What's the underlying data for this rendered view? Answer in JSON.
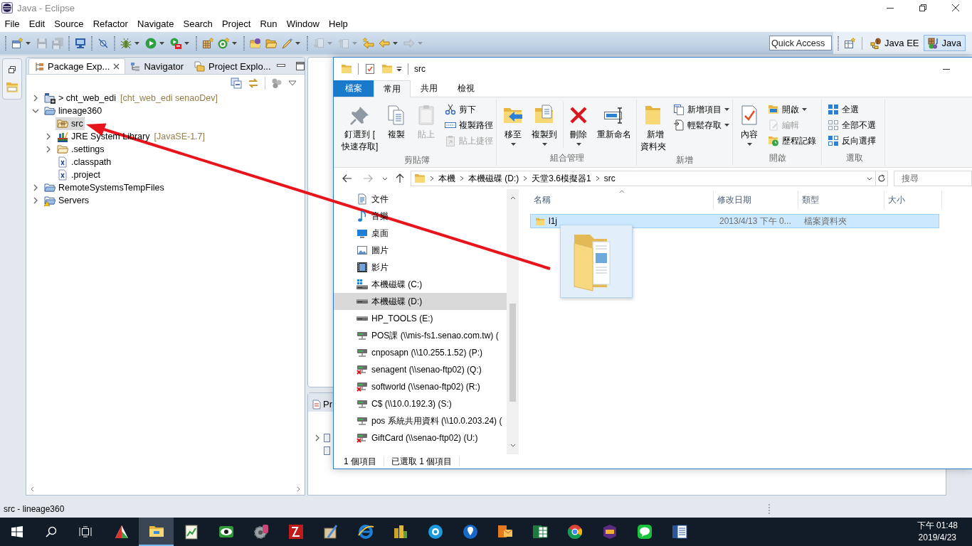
{
  "eclipse": {
    "title": "Java - Eclipse",
    "menu": [
      "File",
      "Edit",
      "Source",
      "Refactor",
      "Navigate",
      "Search",
      "Project",
      "Run",
      "Window",
      "Help"
    ],
    "toolbar": [
      {
        "kind": "grip"
      },
      {
        "kind": "new",
        "disabled": false,
        "dropdown": true
      },
      {
        "kind": "save",
        "disabled": true,
        "dropdown": false
      },
      {
        "kind": "save-all",
        "disabled": true,
        "dropdown": false
      },
      {
        "kind": "grip"
      },
      {
        "kind": "display",
        "disabled": false,
        "dropdown": false
      },
      {
        "kind": "grip"
      },
      {
        "kind": "skip-breakpoints",
        "disabled": false,
        "dropdown": false
      },
      {
        "kind": "grip"
      },
      {
        "kind": "debug",
        "disabled": false,
        "dropdown": true
      },
      {
        "kind": "run",
        "disabled": false,
        "dropdown": true
      },
      {
        "kind": "external-tools",
        "disabled": false,
        "dropdown": true
      },
      {
        "kind": "grip"
      },
      {
        "kind": "open-type",
        "disabled": false,
        "dropdown": false
      },
      {
        "kind": "new-class",
        "disabled": false,
        "dropdown": true
      },
      {
        "kind": "grip"
      },
      {
        "kind": "open-task",
        "disabled": false,
        "dropdown": false
      },
      {
        "kind": "open-folder",
        "disabled": false,
        "dropdown": false
      },
      {
        "kind": "brush",
        "disabled": false,
        "dropdown": true
      },
      {
        "kind": "grip"
      },
      {
        "kind": "next-annotation",
        "disabled": true,
        "dropdown": true
      },
      {
        "kind": "prev-annotation",
        "disabled": true,
        "dropdown": true
      },
      {
        "kind": "last-edit",
        "disabled": false,
        "dropdown": false
      },
      {
        "kind": "back",
        "disabled": false,
        "dropdown": true
      },
      {
        "kind": "forward",
        "disabled": true,
        "dropdown": true
      }
    ],
    "quick_access": {
      "placeholder": "Quick Access"
    },
    "perspectives": [
      {
        "label": "Java EE",
        "selected": false
      },
      {
        "label": "Java",
        "selected": true
      }
    ],
    "view_tabs": [
      {
        "label": "Package Exp...",
        "selected": true
      },
      {
        "label": "Navigator",
        "selected": false
      },
      {
        "label": "Project Explo...",
        "selected": false
      }
    ],
    "tree": [
      {
        "label": "> cht_web_edi",
        "decoration": "[cht_web_edi senaoDev]",
        "kind": "git-project",
        "expanded": false,
        "selected": false
      },
      {
        "label": "lineage360",
        "kind": "project",
        "expanded": true,
        "selected": false,
        "children": [
          {
            "label": "src",
            "kind": "source-folder",
            "selected": true
          },
          {
            "label": "JRE System Library",
            "decoration": "[JavaSE-1.7]",
            "kind": "library",
            "expanded": false,
            "selected": false
          },
          {
            "label": ".settings",
            "kind": "folder",
            "expanded": false,
            "selected": false
          },
          {
            "label": ".classpath",
            "kind": "xml-file",
            "selected": false
          },
          {
            "label": ".project",
            "kind": "xml-file",
            "selected": false
          }
        ]
      },
      {
        "label": "RemoteSystemsTempFiles",
        "kind": "project",
        "expanded": false,
        "selected": false
      },
      {
        "label": "Servers",
        "kind": "project-warning",
        "expanded": false,
        "selected": false
      }
    ],
    "bottom_view_tab": "Pr",
    "status_bar": "src - lineage360"
  },
  "explorer": {
    "title": "src",
    "ribbon_tabs": [
      {
        "label": "檔案",
        "kind": "file",
        "selected": false
      },
      {
        "label": "常用",
        "kind": "tab",
        "selected": true
      },
      {
        "label": "共用",
        "kind": "tab",
        "selected": false
      },
      {
        "label": "檢視",
        "kind": "tab",
        "selected": false
      }
    ],
    "ribbon_groups": [
      {
        "label": "剪貼簿",
        "buttons": [
          {
            "label": "釘選到 [\n快速存取]",
            "kind": "large",
            "disabled": false,
            "dropdown": false
          },
          {
            "label": "複製",
            "kind": "large",
            "disabled": false,
            "dropdown": false
          },
          {
            "label": "貼上",
            "kind": "large",
            "disabled": true,
            "dropdown": false
          },
          {
            "label": "剪下",
            "kind": "small",
            "disabled": false,
            "dropdown": false
          },
          {
            "label": "複製路徑",
            "kind": "small",
            "disabled": false,
            "dropdown": false
          },
          {
            "label": "貼上捷徑",
            "kind": "small",
            "disabled": true,
            "dropdown": false
          }
        ]
      },
      {
        "label": "組合管理",
        "buttons": [
          {
            "label": "移至",
            "kind": "large",
            "disabled": false,
            "dropdown": true
          },
          {
            "label": "複製到",
            "kind": "large",
            "disabled": false,
            "dropdown": true
          },
          {
            "label": "刪除",
            "kind": "large",
            "disabled": false,
            "dropdown": true
          },
          {
            "label": "重新命名",
            "kind": "large",
            "disabled": false,
            "dropdown": false
          }
        ]
      },
      {
        "label": "新增",
        "buttons": [
          {
            "label": "新增資料夾",
            "kind": "large",
            "disabled": false,
            "dropdown": false
          },
          {
            "label": "新增項目",
            "kind": "small",
            "disabled": false,
            "dropdown": true
          },
          {
            "label": "輕鬆存取",
            "kind": "small",
            "disabled": false,
            "dropdown": true
          }
        ]
      },
      {
        "label": "開啟",
        "buttons": [
          {
            "label": "內容",
            "kind": "large",
            "disabled": false,
            "dropdown": true
          },
          {
            "label": "開啟",
            "kind": "small",
            "disabled": false,
            "dropdown": true
          },
          {
            "label": "編輯",
            "kind": "small",
            "disabled": true,
            "dropdown": false
          },
          {
            "label": "歷程記錄",
            "kind": "small",
            "disabled": false,
            "dropdown": false
          }
        ]
      },
      {
        "label": "選取",
        "buttons": [
          {
            "label": "全選",
            "kind": "small",
            "disabled": false,
            "dropdown": false
          },
          {
            "label": "全部不選",
            "kind": "small",
            "disabled": false,
            "dropdown": false
          },
          {
            "label": "反向選擇",
            "kind": "small",
            "disabled": false,
            "dropdown": false
          }
        ]
      }
    ],
    "nav": [
      {
        "kind": "back",
        "disabled": false
      },
      {
        "kind": "forward",
        "disabled": true
      },
      {
        "kind": "recent",
        "disabled": false
      },
      {
        "kind": "up",
        "disabled": false
      }
    ],
    "breadcrumbs": [
      "本機",
      "本機磁碟 (D:)",
      "天堂3.6模擬器1",
      "src"
    ],
    "search": {
      "placeholder": "搜尋"
    },
    "nav_pane": [
      {
        "label": "文件",
        "kind": "documents",
        "selected": false
      },
      {
        "label": "音樂",
        "kind": "music",
        "selected": false
      },
      {
        "label": "桌面",
        "kind": "desktop",
        "selected": false
      },
      {
        "label": "圖片",
        "kind": "pictures",
        "selected": false
      },
      {
        "label": "影片",
        "kind": "videos",
        "selected": false
      },
      {
        "label": "本機磁碟 (C:)",
        "kind": "system-drive",
        "selected": false
      },
      {
        "label": "本機磁碟 (D:)",
        "kind": "drive",
        "selected": true
      },
      {
        "label": "HP_TOOLS (E:)",
        "kind": "drive",
        "selected": false
      },
      {
        "label": "POS課 (\\\\mis-fs1.senao.com.tw) (",
        "kind": "network-drive",
        "selected": false
      },
      {
        "label": "cnposapn (\\\\10.255.1.52) (P:)",
        "kind": "network-drive",
        "selected": false
      },
      {
        "label": "senagent (\\\\senao-ftp02) (Q:)",
        "kind": "disconnected-drive",
        "selected": false
      },
      {
        "label": "softworld (\\\\senao-ftp02) (R:)",
        "kind": "disconnected-drive",
        "selected": false
      },
      {
        "label": "C$ (\\\\10.0.192.3) (S:)",
        "kind": "network-drive",
        "selected": false
      },
      {
        "label": "pos 系統共用資料 (\\\\10.0.203.24) (",
        "kind": "network-drive",
        "selected": false
      },
      {
        "label": "GiftCard (\\\\senao-ftp02) (U:)",
        "kind": "disconnected-drive",
        "selected": false
      }
    ],
    "columns": [
      {
        "label": "名稱",
        "sorted": true
      },
      {
        "label": "修改日期",
        "sorted": false
      },
      {
        "label": "類型",
        "sorted": false
      },
      {
        "label": "大小",
        "sorted": false
      }
    ],
    "rows": [
      {
        "name": "l1j",
        "modified": "2013/4/13 下午 0...",
        "type": "檔案資料夾",
        "selected": true
      }
    ],
    "status": [
      "1 個項目",
      "已選取 1 個項目"
    ]
  },
  "taskbar": {
    "apps": [
      {
        "selected": false
      },
      {
        "selected": true
      },
      {
        "selected": false
      },
      {
        "selected": false
      },
      {
        "selected": false
      },
      {
        "selected": false
      },
      {
        "selected": false
      },
      {
        "selected": false
      },
      {
        "selected": false
      },
      {
        "selected": false
      },
      {
        "selected": false
      },
      {
        "selected": false
      },
      {
        "selected": false
      },
      {
        "selected": false
      },
      {
        "selected": false
      },
      {
        "selected": false
      },
      {
        "selected": false
      }
    ],
    "time": "下午 01:48",
    "date": "2019/4/23"
  }
}
